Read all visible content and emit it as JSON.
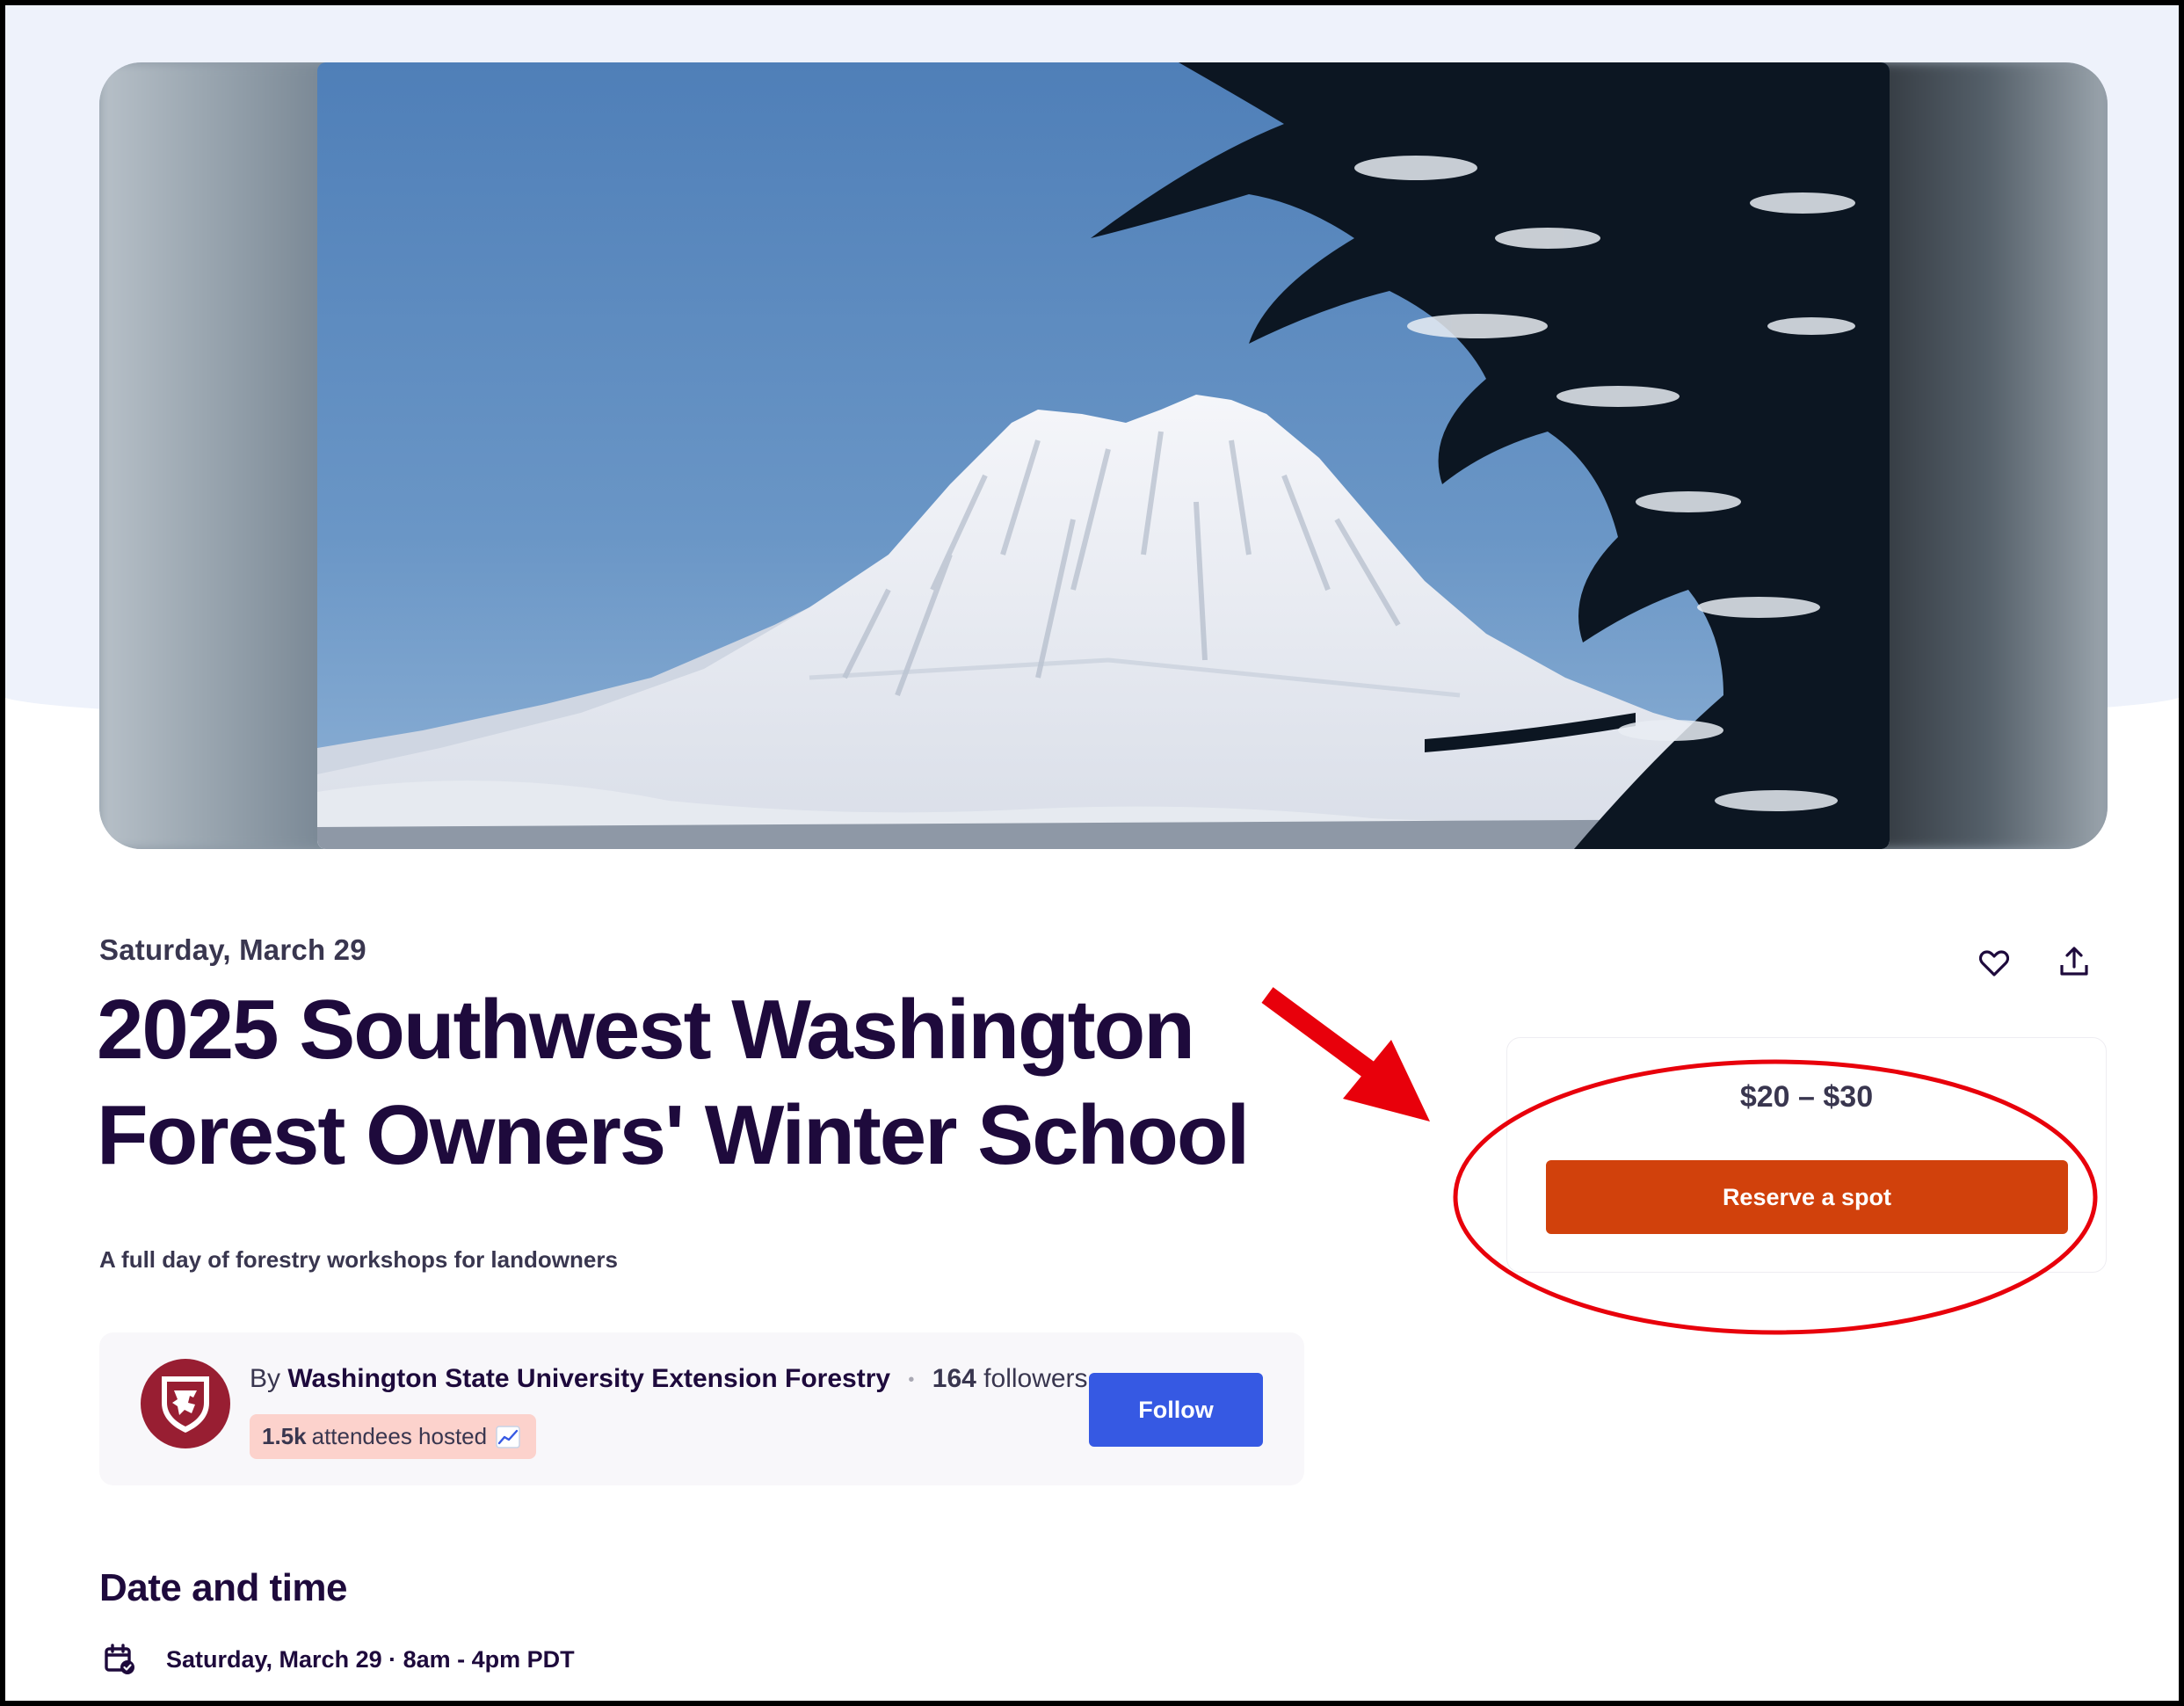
{
  "event": {
    "date_short": "Saturday, March 29",
    "title": "2025 Southwest Washington Forest Owners' Winter School",
    "summary": "A full day of forestry workshops for landowners"
  },
  "organizer": {
    "by_label": "By",
    "name": "Washington State University Extension Forestry",
    "followers_count": "164",
    "followers_label": "followers",
    "attendees_count": "1.5k",
    "attendees_label": "attendees hosted",
    "follow_label": "Follow"
  },
  "tickets": {
    "price_range": "$20 – $30",
    "reserve_label": "Reserve a spot"
  },
  "date_section": {
    "heading": "Date and time",
    "datetime": "Saturday, March 29 · 8am - 4pm PDT"
  },
  "icons": {
    "like": "heart-icon",
    "share": "share-icon",
    "calendar": "calendar-check-icon",
    "trend": "chart-increasing-icon",
    "org_logo": "wsu-cougar-logo"
  },
  "colors": {
    "primary_text": "#1e0a3c",
    "reserve_button": "#d1410c",
    "follow_button": "#3659e3",
    "annotation_red": "#e8000b",
    "badge_bg": "#fcd2cc"
  }
}
